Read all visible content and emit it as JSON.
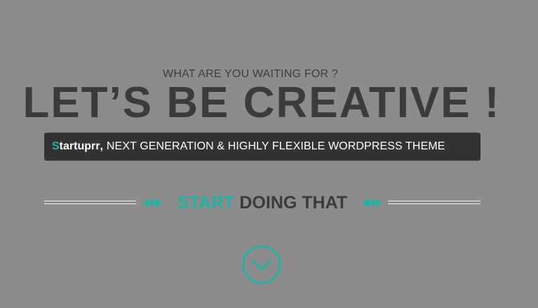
{
  "hero": {
    "eyebrow": "WHAT ARE YOU WAITING FOR ?",
    "headline": "LET’S BE CREATIVE !",
    "tagline": {
      "brand_first_letter": "S",
      "brand_rest": "tartuprr",
      "brand_comma": ",",
      "text": "NEXT GENERATION & HIGHLY FLEXIBLE WORDPRESS THEME"
    },
    "cta": {
      "accent": "START",
      "rest": "DOING THAT",
      "left_arrow_icon": "double-arrow-left-icon",
      "right_arrow_icon": "double-arrow-right-icon"
    },
    "scroll_icon": "chevron-down-circle-icon"
  },
  "colors": {
    "background": "#8c8c8c",
    "accent": "#1fb5a6",
    "dark_text": "#3b3b3b",
    "bar": "#333333",
    "rule": "#ececec"
  }
}
